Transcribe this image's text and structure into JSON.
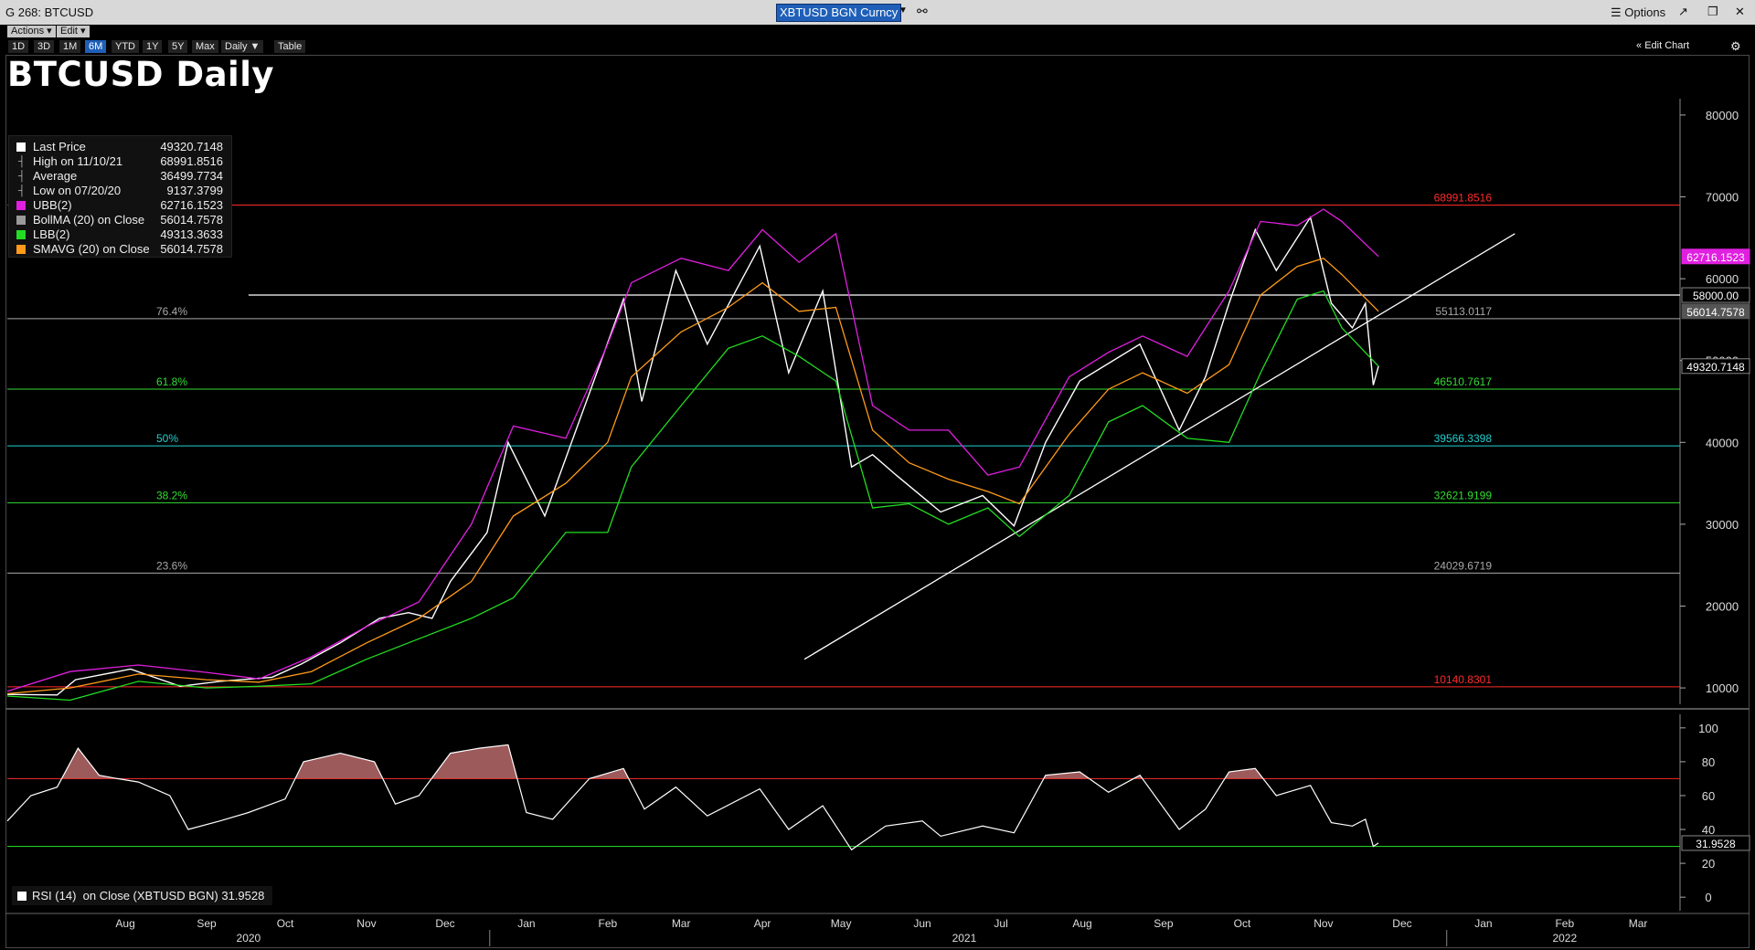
{
  "window": {
    "title": "G 268: BTCUSD",
    "ticker": "XBTUSD BGN Curncy",
    "options_label": "Options",
    "actions_label": "Actions",
    "edit_label": "Edit",
    "table_label": "Table",
    "edit_chart_label": "Edit Chart",
    "periodicity": "Daily",
    "ranges": [
      "1D",
      "3D",
      "1M",
      "6M",
      "YTD",
      "1Y",
      "5Y",
      "Max"
    ],
    "active_range": "6M"
  },
  "chart_data": {
    "type": "line",
    "title": "BTCUSD Daily",
    "x_start": "2020-07-01",
    "x_end": "2022-03-31",
    "ylim": [
      8000,
      82000
    ],
    "yticks": [
      10000,
      20000,
      30000,
      40000,
      50000,
      60000,
      70000,
      80000
    ],
    "month_ticks": [
      "Aug",
      "Sep",
      "Oct",
      "Nov",
      "Dec",
      "Jan",
      "Feb",
      "Mar",
      "Apr",
      "May",
      "Jun",
      "Jul",
      "Aug",
      "Sep",
      "Oct",
      "Nov",
      "Dec",
      "Jan",
      "Feb",
      "Mar"
    ],
    "year_labels": [
      "2020",
      "2021",
      "2022"
    ],
    "legend": [
      {
        "label": "Last Price",
        "extra": "",
        "value": "49320.7148",
        "color": "#ffffff"
      },
      {
        "label": "High on 11/10/21",
        "extra": "",
        "value": "68991.8516",
        "color": ""
      },
      {
        "label": "Average",
        "extra": "",
        "value": "36499.7734",
        "color": ""
      },
      {
        "label": "Low on 07/20/20",
        "extra": "",
        "value": "9137.3799",
        "color": ""
      },
      {
        "label": "UBB(2)",
        "extra": "",
        "value": "62716.1523",
        "color": "#e020e0"
      },
      {
        "label": "BollMA (20)",
        "extra": "on Close",
        "value": "56014.7578",
        "color": "#999999"
      },
      {
        "label": "LBB(2)",
        "extra": "",
        "value": "49313.3633",
        "color": "#22dd22"
      },
      {
        "label": "SMAVG (20)",
        "extra": "on Close",
        "value": "56014.7578",
        "color": "#ff9a1a"
      }
    ],
    "series": [
      {
        "name": "Last Price",
        "color": "#ffffff",
        "points": [
          [
            "2020-07-01",
            9200
          ],
          [
            "2020-07-20",
            9137
          ],
          [
            "2020-07-27",
            11000
          ],
          [
            "2020-08-17",
            12300
          ],
          [
            "2020-09-05",
            10200
          ],
          [
            "2020-09-20",
            10800
          ],
          [
            "2020-10-10",
            11300
          ],
          [
            "2020-10-21",
            12900
          ],
          [
            "2020-11-05",
            15500
          ],
          [
            "2020-11-20",
            18500
          ],
          [
            "2020-12-01",
            19200
          ],
          [
            "2020-12-10",
            18500
          ],
          [
            "2020-12-17",
            23000
          ],
          [
            "2020-12-31",
            29000
          ],
          [
            "2021-01-08",
            40000
          ],
          [
            "2021-01-22",
            31000
          ],
          [
            "2021-02-08",
            46000
          ],
          [
            "2021-02-21",
            57500
          ],
          [
            "2021-02-28",
            45000
          ],
          [
            "2021-03-13",
            61000
          ],
          [
            "2021-03-25",
            52000
          ],
          [
            "2021-04-14",
            64000
          ],
          [
            "2021-04-25",
            48500
          ],
          [
            "2021-05-08",
            58500
          ],
          [
            "2021-05-19",
            37000
          ],
          [
            "2021-05-27",
            38500
          ],
          [
            "2021-06-05",
            36000
          ],
          [
            "2021-06-22",
            31500
          ],
          [
            "2021-07-08",
            33500
          ],
          [
            "2021-07-20",
            29800
          ],
          [
            "2021-08-01",
            40000
          ],
          [
            "2021-08-14",
            47500
          ],
          [
            "2021-09-06",
            52000
          ],
          [
            "2021-09-21",
            41500
          ],
          [
            "2021-10-01",
            48000
          ],
          [
            "2021-10-10",
            57000
          ],
          [
            "2021-10-20",
            66000
          ],
          [
            "2021-10-28",
            61000
          ],
          [
            "2021-11-10",
            67500
          ],
          [
            "2021-11-18",
            57000
          ],
          [
            "2021-11-26",
            54000
          ],
          [
            "2021-12-01",
            57000
          ],
          [
            "2021-12-04",
            47000
          ],
          [
            "2021-12-06",
            49320.7148
          ]
        ]
      },
      {
        "name": "UBB(2)",
        "color": "#e020e0",
        "points": [
          [
            "2020-07-01",
            9600
          ],
          [
            "2020-07-25",
            12000
          ],
          [
            "2020-08-20",
            12800
          ],
          [
            "2020-09-15",
            11900
          ],
          [
            "2020-10-05",
            11100
          ],
          [
            "2020-10-25",
            13800
          ],
          [
            "2020-11-15",
            17500
          ],
          [
            "2020-12-05",
            20500
          ],
          [
            "2020-12-25",
            30000
          ],
          [
            "2021-01-10",
            42000
          ],
          [
            "2021-01-30",
            40500
          ],
          [
            "2021-02-15",
            52000
          ],
          [
            "2021-02-24",
            59500
          ],
          [
            "2021-03-15",
            62500
          ],
          [
            "2021-04-02",
            61000
          ],
          [
            "2021-04-15",
            66000
          ],
          [
            "2021-04-29",
            62000
          ],
          [
            "2021-05-13",
            65500
          ],
          [
            "2021-05-27",
            44500
          ],
          [
            "2021-06-10",
            41500
          ],
          [
            "2021-06-25",
            41500
          ],
          [
            "2021-07-10",
            36000
          ],
          [
            "2021-07-22",
            37000
          ],
          [
            "2021-08-10",
            48000
          ],
          [
            "2021-08-25",
            51000
          ],
          [
            "2021-09-07",
            53000
          ],
          [
            "2021-09-24",
            50500
          ],
          [
            "2021-10-10",
            58500
          ],
          [
            "2021-10-22",
            67000
          ],
          [
            "2021-11-05",
            66500
          ],
          [
            "2021-11-15",
            68500
          ],
          [
            "2021-11-22",
            67000
          ],
          [
            "2021-12-06",
            62716.1523
          ]
        ]
      },
      {
        "name": "SMAVG (20)",
        "color": "#ff9a1a",
        "points": [
          [
            "2020-07-01",
            9300
          ],
          [
            "2020-07-25",
            10000
          ],
          [
            "2020-08-20",
            11700
          ],
          [
            "2020-09-15",
            11000
          ],
          [
            "2020-10-05",
            10700
          ],
          [
            "2020-10-25",
            12000
          ],
          [
            "2020-11-15",
            15500
          ],
          [
            "2020-12-05",
            18500
          ],
          [
            "2020-12-25",
            23000
          ],
          [
            "2021-01-10",
            31000
          ],
          [
            "2021-01-30",
            35000
          ],
          [
            "2021-02-15",
            40000
          ],
          [
            "2021-02-24",
            48000
          ],
          [
            "2021-03-15",
            53500
          ],
          [
            "2021-04-02",
            56500
          ],
          [
            "2021-04-15",
            59500
          ],
          [
            "2021-04-29",
            56000
          ],
          [
            "2021-05-13",
            56500
          ],
          [
            "2021-05-27",
            41500
          ],
          [
            "2021-06-10",
            37500
          ],
          [
            "2021-06-25",
            35500
          ],
          [
            "2021-07-10",
            34000
          ],
          [
            "2021-07-22",
            32500
          ],
          [
            "2021-08-10",
            41000
          ],
          [
            "2021-08-25",
            46500
          ],
          [
            "2021-09-07",
            48500
          ],
          [
            "2021-09-24",
            46000
          ],
          [
            "2021-10-10",
            49500
          ],
          [
            "2021-10-22",
            58000
          ],
          [
            "2021-11-05",
            61500
          ],
          [
            "2021-11-15",
            62500
          ],
          [
            "2021-11-22",
            60500
          ],
          [
            "2021-12-06",
            56014.7578
          ]
        ]
      },
      {
        "name": "LBB(2)",
        "color": "#22dd22",
        "points": [
          [
            "2020-07-01",
            9000
          ],
          [
            "2020-07-25",
            8500
          ],
          [
            "2020-08-20",
            10800
          ],
          [
            "2020-09-15",
            10000
          ],
          [
            "2020-10-05",
            10200
          ],
          [
            "2020-10-25",
            10500
          ],
          [
            "2020-11-15",
            13500
          ],
          [
            "2020-12-05",
            16000
          ],
          [
            "2020-12-25",
            18500
          ],
          [
            "2021-01-10",
            21000
          ],
          [
            "2021-01-30",
            29000
          ],
          [
            "2021-02-15",
            29000
          ],
          [
            "2021-02-24",
            37000
          ],
          [
            "2021-03-15",
            44500
          ],
          [
            "2021-04-02",
            51500
          ],
          [
            "2021-04-15",
            53000
          ],
          [
            "2021-04-29",
            50500
          ],
          [
            "2021-05-13",
            47500
          ],
          [
            "2021-05-27",
            32000
          ],
          [
            "2021-06-10",
            32500
          ],
          [
            "2021-06-25",
            30000
          ],
          [
            "2021-07-10",
            32000
          ],
          [
            "2021-07-22",
            28500
          ],
          [
            "2021-08-10",
            33500
          ],
          [
            "2021-08-25",
            42500
          ],
          [
            "2021-09-07",
            44500
          ],
          [
            "2021-09-24",
            40500
          ],
          [
            "2021-10-10",
            40000
          ],
          [
            "2021-10-22",
            48500
          ],
          [
            "2021-11-05",
            57500
          ],
          [
            "2021-11-15",
            58500
          ],
          [
            "2021-11-22",
            54000
          ],
          [
            "2021-12-06",
            49313.3633
          ]
        ]
      }
    ],
    "fib_levels": [
      {
        "pct": "",
        "value": 68991.8516,
        "label": "68991.8516",
        "color": "#ff2a2a"
      },
      {
        "pct": "76.4%",
        "value": 55113.0117,
        "label": "55113.0117",
        "color": "#a8a8a8"
      },
      {
        "pct": "61.8%",
        "value": 46510.7617,
        "label": "46510.7617",
        "color": "#33dd33"
      },
      {
        "pct": "50%",
        "value": 39566.3398,
        "label": "39566.3398",
        "color": "#20d0d0"
      },
      {
        "pct": "38.2%",
        "value": 32621.9199,
        "label": "32621.9199",
        "color": "#33dd33"
      },
      {
        "pct": "23.6%",
        "value": 24029.6719,
        "label": "24029.6719",
        "color": "#a8a8a8"
      },
      {
        "pct": "",
        "value": 10140.8301,
        "label": "10140.8301",
        "color": "#ff2a2a"
      }
    ],
    "horizontal_line": {
      "value": 58000,
      "label": "58000.00",
      "start": "2020-10-01",
      "end": "2022-03-31",
      "color": "#ffffff"
    },
    "trendline": {
      "start": [
        "2021-05-01",
        13500
      ],
      "end": [
        "2022-01-27",
        65500
      ],
      "color": "#ffffff"
    },
    "price_tags": [
      {
        "value": 62716.1523,
        "label": "62716.1523",
        "bg": "#e020e0",
        "fg": "#ffffff"
      },
      {
        "value": 58000,
        "label": "58000.00",
        "bg": "#000000",
        "fg": "#ffffff"
      },
      {
        "value": 56014.7578,
        "label": "56014.7578",
        "bg": "#555555",
        "fg": "#ffffff"
      },
      {
        "value": 49320.7148,
        "label": "49320.7148",
        "bg": "#000000",
        "fg": "#ffffff"
      }
    ],
    "rsi": {
      "label": "RSI (14)",
      "extra": "on Close (XBTUSD BGN)",
      "value": 31.9528,
      "value_label": "31.9528",
      "ylim": [
        -8,
        108
      ],
      "yticks": [
        0,
        20,
        40,
        60,
        80,
        100
      ],
      "upper": 70,
      "lower": 30,
      "points": [
        [
          "2020-07-01",
          45
        ],
        [
          "2020-07-10",
          60
        ],
        [
          "2020-07-20",
          65
        ],
        [
          "2020-07-28",
          88
        ],
        [
          "2020-08-05",
          72
        ],
        [
          "2020-08-12",
          70
        ],
        [
          "2020-08-20",
          68
        ],
        [
          "2020-09-01",
          60
        ],
        [
          "2020-09-08",
          40
        ],
        [
          "2020-09-20",
          45
        ],
        [
          "2020-10-01",
          50
        ],
        [
          "2020-10-15",
          58
        ],
        [
          "2020-10-22",
          80
        ],
        [
          "2020-11-05",
          85
        ],
        [
          "2020-11-18",
          80
        ],
        [
          "2020-11-26",
          55
        ],
        [
          "2020-12-05",
          60
        ],
        [
          "2020-12-17",
          85
        ],
        [
          "2020-12-28",
          88
        ],
        [
          "2021-01-08",
          90
        ],
        [
          "2021-01-15",
          50
        ],
        [
          "2021-01-25",
          46
        ],
        [
          "2021-02-08",
          70
        ],
        [
          "2021-02-21",
          76
        ],
        [
          "2021-03-01",
          52
        ],
        [
          "2021-03-13",
          65
        ],
        [
          "2021-03-25",
          48
        ],
        [
          "2021-04-14",
          64
        ],
        [
          "2021-04-25",
          40
        ],
        [
          "2021-05-08",
          54
        ],
        [
          "2021-05-19",
          28
        ],
        [
          "2021-06-01",
          42
        ],
        [
          "2021-06-15",
          45
        ],
        [
          "2021-06-22",
          36
        ],
        [
          "2021-07-08",
          42
        ],
        [
          "2021-07-20",
          38
        ],
        [
          "2021-08-01",
          72
        ],
        [
          "2021-08-14",
          74
        ],
        [
          "2021-08-25",
          62
        ],
        [
          "2021-09-06",
          72
        ],
        [
          "2021-09-21",
          40
        ],
        [
          "2021-10-01",
          52
        ],
        [
          "2021-10-10",
          74
        ],
        [
          "2021-10-20",
          76
        ],
        [
          "2021-10-28",
          60
        ],
        [
          "2021-11-10",
          66
        ],
        [
          "2021-11-18",
          44
        ],
        [
          "2021-11-26",
          42
        ],
        [
          "2021-12-01",
          46
        ],
        [
          "2021-12-04",
          30
        ],
        [
          "2021-12-06",
          31.9528
        ]
      ]
    }
  }
}
